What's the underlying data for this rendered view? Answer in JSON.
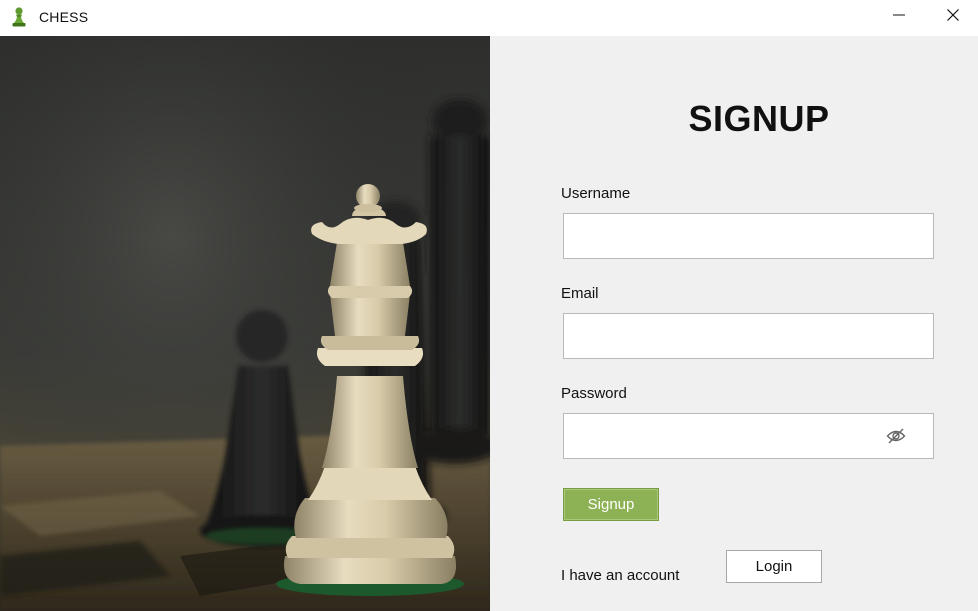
{
  "window": {
    "title": "CHESS",
    "icon": "chess-pawn-icon",
    "controls": [
      "minimize-icon",
      "close-icon"
    ]
  },
  "hero": {
    "image": "chess-queen-photo"
  },
  "form": {
    "heading": "SIGNUP",
    "username": {
      "label": "Username",
      "value": ""
    },
    "email": {
      "label": "Email",
      "value": ""
    },
    "password": {
      "label": "Password",
      "value": "",
      "toggle_icon": "eye-slash-icon"
    },
    "signup_button": "Signup",
    "account_prompt": "I have an account",
    "login_button": "Login"
  },
  "colors": {
    "accent_green": "#8db255",
    "panel_background": "#f0f0f0",
    "titlebar_background": "#ffffff"
  }
}
